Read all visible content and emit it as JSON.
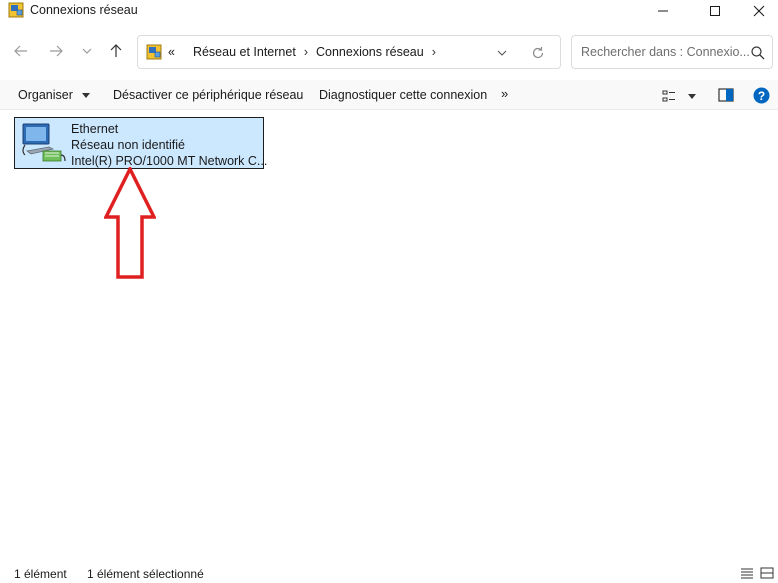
{
  "window": {
    "title": "Connexions réseau",
    "icons": {
      "app": "network-connections-icon",
      "minimize": "minimize-icon",
      "maximize": "maximize-icon",
      "close": "close-icon"
    }
  },
  "nav": {
    "icons": {
      "back": "arrow-left-icon",
      "forward": "arrow-right-icon",
      "recent": "chevron-down-icon",
      "up": "arrow-up-icon"
    }
  },
  "address": {
    "overflow": "«",
    "breadcrumbs": [
      "Réseau et Internet",
      "Connexions réseau"
    ],
    "separator": "›",
    "icons": {
      "location": "network-connections-icon",
      "dropdown": "chevron-down-icon",
      "refresh": "refresh-icon"
    }
  },
  "search": {
    "placeholder": "Rechercher dans : Connexio...",
    "icon": "search-icon"
  },
  "commands": {
    "organiser": "Organiser",
    "disable_device": "Désactiver ce périphérique réseau",
    "diagnose": "Diagnostiquer cette connexion",
    "more": "»",
    "icons": {
      "view": "view-options-icon",
      "preview_pane": "preview-pane-icon",
      "help": "help-icon"
    }
  },
  "connections": [
    {
      "name": "Ethernet",
      "status": "Réseau non identifié",
      "adapter": "Intel(R) PRO/1000 MT Network C...",
      "selected": true,
      "icon": "ethernet-adapter-icon"
    }
  ],
  "annotation": {
    "shape": "red-outline-arrow-up",
    "color": "#e02020"
  },
  "status_bar": {
    "item_count": "1 élément",
    "selected_count": "1 élément sélectionné",
    "icons": {
      "details_view": "details-view-icon",
      "tiles_view": "tiles-view-icon"
    }
  },
  "colors": {
    "selection_bg": "#cce8ff",
    "accent": "#0067c0",
    "annotation": "#e02020"
  }
}
